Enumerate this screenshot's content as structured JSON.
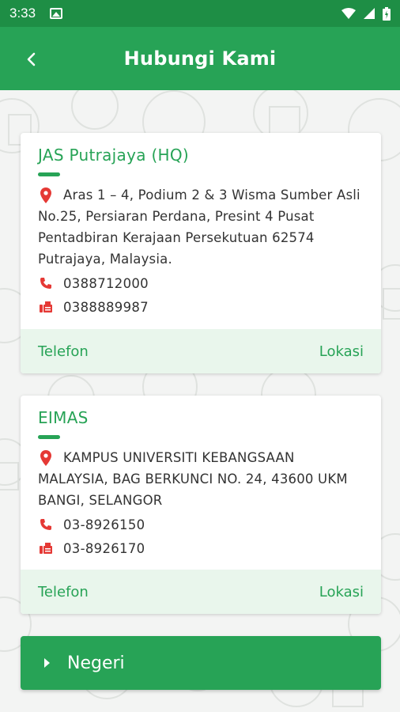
{
  "status_bar": {
    "time": "3:33",
    "icons": [
      "image-notification-icon",
      "wifi-icon",
      "signal-icon",
      "battery-icon"
    ]
  },
  "app_bar": {
    "title": "Hubungi Kami",
    "back_icon": "chevron-left-icon"
  },
  "colors": {
    "primary": "#27a356",
    "status_bar": "#1e8e45",
    "action_bg": "#e9f6ec",
    "icon_red": "#e53935"
  },
  "offices": [
    {
      "name": "JAS Putrajaya (HQ)",
      "address": "Aras 1 – 4, Podium 2 & 3 Wisma Sumber Asli No.25, Persiaran Perdana, Presint 4 Pusat Pentadbiran Kerajaan Persekutuan 62574 Putrajaya, Malaysia.",
      "phone": "0388712000",
      "fax": "0388889987",
      "call_label": "Telefon",
      "location_label": "Lokasi"
    },
    {
      "name": "EIMAS",
      "address": "KAMPUS UNIVERSITI KEBANGSAAN MALAYSIA, BAG BERKUNCI NO. 24, 43600 UKM BANGI, SELANGOR",
      "phone": "03-8926150",
      "fax": "03-8926170",
      "call_label": "Telefon",
      "location_label": "Lokasi"
    }
  ],
  "negeri": {
    "label": "Negeri",
    "icon": "caret-right-icon"
  }
}
